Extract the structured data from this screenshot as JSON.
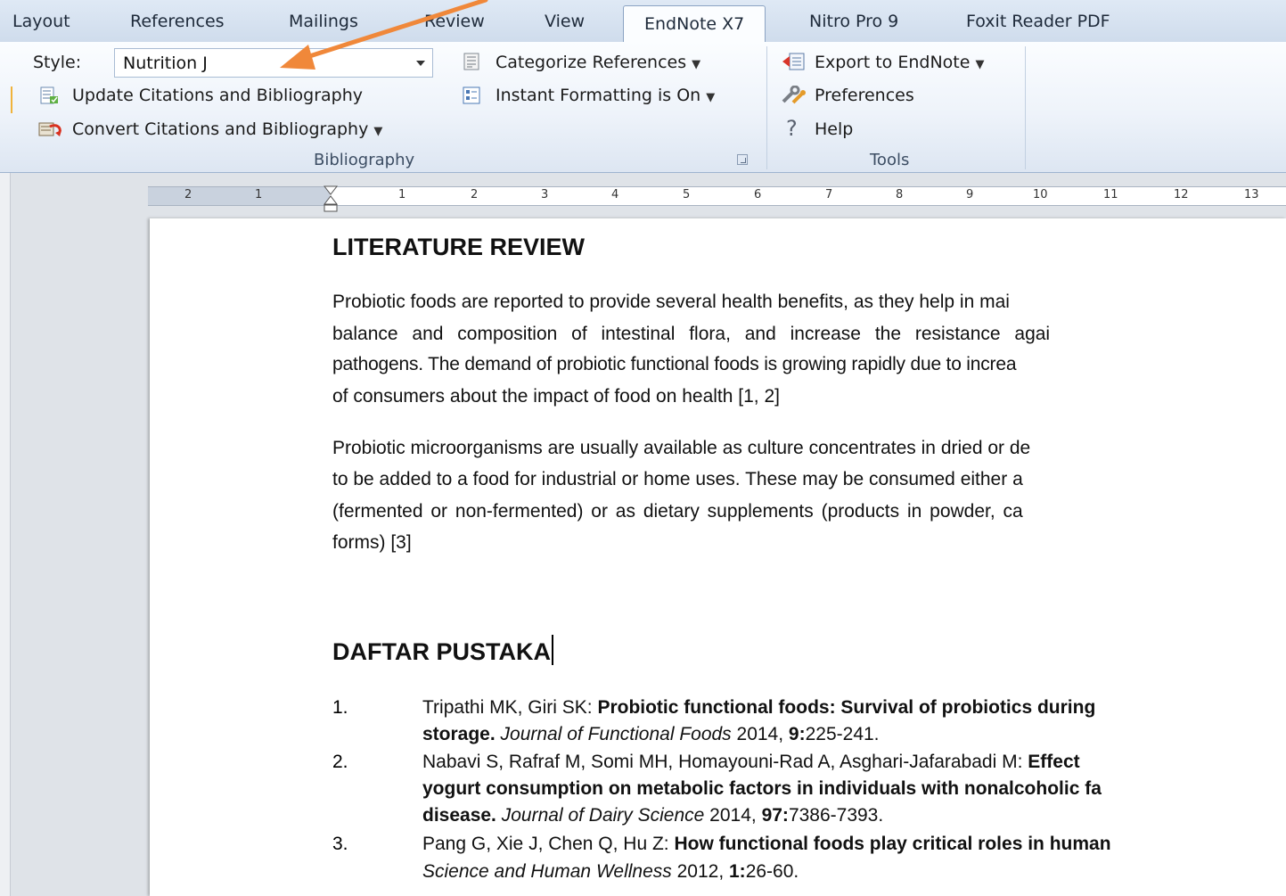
{
  "tabs": [
    "Layout",
    "References",
    "Mailings",
    "Review",
    "View",
    "EndNote X7",
    "Nitro Pro 9",
    "Foxit Reader PDF"
  ],
  "ribbon": {
    "style_label": "Style:",
    "style_value": "Nutrition J",
    "update_citations": "Update Citations and Bibliography",
    "convert_citations": "Convert Citations and Bibliography",
    "categorize_references": "Categorize References",
    "instant_formatting": "Instant Formatting is On",
    "bibliography_group": "Bibliography",
    "export_endnote": "Export to EndNote",
    "preferences": "Preferences",
    "help": "Help",
    "tools_group": "Tools"
  },
  "ruler": [
    "2",
    "1",
    "1",
    "2",
    "3",
    "4",
    "5",
    "6",
    "7",
    "8",
    "9",
    "10",
    "11",
    "12",
    "13"
  ],
  "document": {
    "heading1": "LITERATURE REVIEW",
    "para1": [
      "Probiotic foods are reported to provide several health benefits, as they help in mai",
      "balance and composition of intestinal flora, and increase the resistance agai",
      "pathogens. The demand of probiotic functional foods is growing rapidly due to increa",
      "of consumers about the impact of food on health [1, 2]"
    ],
    "para2": [
      "Probiotic microorganisms are usually available as culture concentrates in dried or de",
      "to be added to a food for industrial or home uses. These may be consumed either a",
      "(fermented or non-fermented) or as dietary supplements (products in powder, ca",
      "forms) [3]"
    ],
    "heading2": "DAFTAR PUSTAKA",
    "references": [
      {
        "num": "1.",
        "line1_authors": "Tripathi MK, Giri SK: ",
        "line1_title": "Probiotic functional foods: Survival of probiotics during",
        "line2_title": "storage. ",
        "line2_journal": "Journal of Functional Foods",
        "line2_year": " 2014, ",
        "line2_vol": "9:",
        "line2_pages": "225-241."
      },
      {
        "num": "2.",
        "line1_authors": "Nabavi S, Rafraf M, Somi MH, Homayouni-Rad A, Asghari-Jafarabadi M: ",
        "line1_title": "Effect",
        "line2_title": "yogurt consumption on metabolic factors in individuals with nonalcoholic fa",
        "line3_title": "disease. ",
        "line3_journal": "Journal of Dairy Science",
        "line3_year": " 2014,  ",
        "line3_vol": "97:",
        "line3_pages": "7386-7393."
      },
      {
        "num": "3.",
        "line1_authors": "Pang G, Xie J, Chen Q, Hu Z: ",
        "line1_title": "How functional foods play critical roles in human",
        "line2_journal": "Science and Human Wellness",
        "line2_year": " 2012,  ",
        "line2_vol": "1:",
        "line2_pages": "26-60."
      }
    ]
  },
  "colors": {
    "annotation_arrow": "#f0883a",
    "ribbon_bg": "#eef3fa",
    "workspace_bg": "#dfe3e8"
  }
}
